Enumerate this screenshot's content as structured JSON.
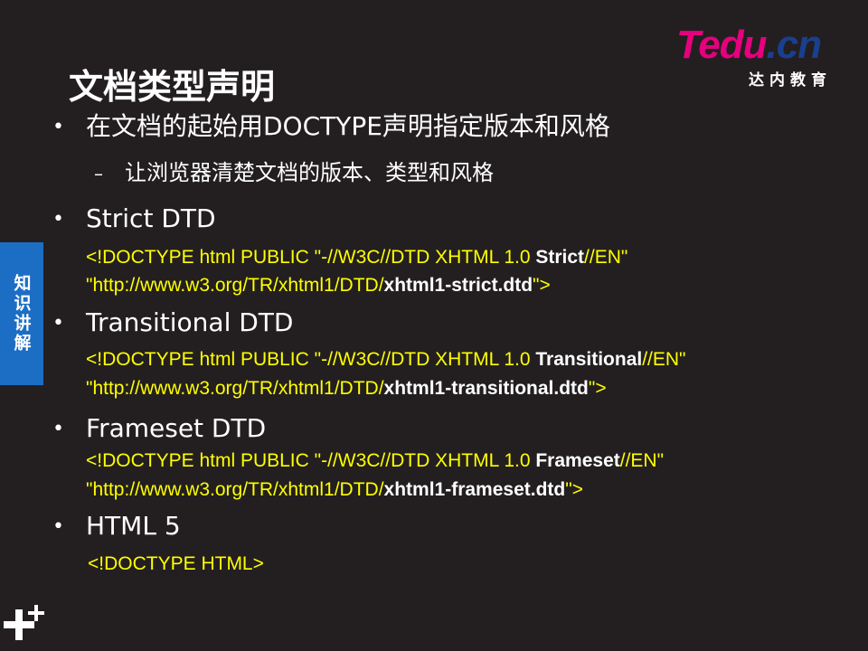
{
  "logo": {
    "mark_main": "Tedu",
    "mark_suffix": ".cn",
    "subtitle": "达内教育"
  },
  "title": "文档类型声明",
  "side_tab": "知识讲解",
  "bullet_symbol": "•",
  "dash_symbol": "–",
  "items": [
    {
      "text": "在文档的起始用DOCTYPE声明指定版本和风格",
      "sub": "让浏览器清楚文档的版本、类型和风格"
    },
    {
      "text": "Strict DTD",
      "l1_pre": "<!DOCTYPE html PUBLIC \"-//W3C//DTD XHTML 1.0 ",
      "l1_bold": "Strict",
      "l1_post": "//EN\"",
      "l2_pre": "\"http://www.w3.org/TR/xhtml1/DTD/",
      "l2_bold": "xhtml1-strict.dtd",
      "l2_post": "\">"
    },
    {
      "text": "Transitional DTD",
      "l1_pre": "<!DOCTYPE html PUBLIC \"-//W3C//DTD XHTML 1.0 ",
      "l1_bold": "Transitional",
      "l1_post": "//EN\"",
      "l2_pre": "\"http://www.w3.org/TR/xhtml1/DTD/",
      "l2_bold": "xhtml1-transitional.dtd",
      "l2_post": "\">"
    },
    {
      "text": "Frameset DTD",
      "l1_pre": "<!DOCTYPE html PUBLIC \"-//W3C//DTD XHTML 1.0 ",
      "l1_bold": "Frameset",
      "l1_post": "//EN\"",
      "l2_pre": "\"http://www.w3.org/TR/xhtml1/DTD/",
      "l2_bold": "xhtml1-frameset.dtd",
      "l2_post": "\">"
    },
    {
      "text": "HTML 5",
      "code": "<!DOCTYPE HTML>"
    }
  ],
  "colors": {
    "background": "#231f20",
    "code": "#ffff00",
    "side_tab": "#1c6ec4",
    "logo_pink": "#e6007e",
    "logo_blue": "#1a3f8f"
  }
}
